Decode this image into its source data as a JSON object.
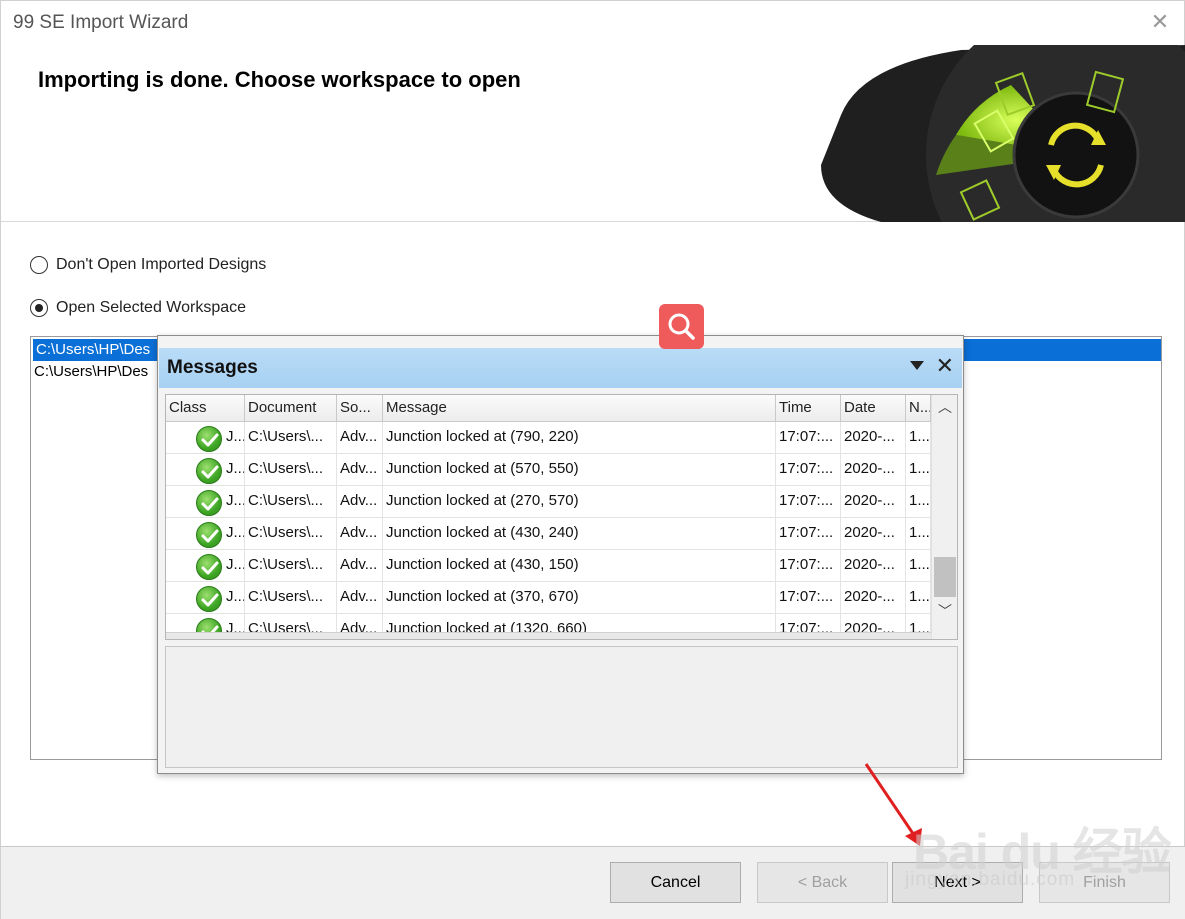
{
  "window": {
    "title": "99 SE Import Wizard",
    "close_icon": "close-icon"
  },
  "header": {
    "headline": "Importing is done. Choose workspace to open"
  },
  "options": [
    {
      "label": "Don't Open Imported Designs",
      "checked": false
    },
    {
      "label": "Open Selected Workspace",
      "checked": true
    }
  ],
  "workspaces": [
    {
      "path": "C:\\Users\\HP\\Des",
      "selected": true
    },
    {
      "path": "C:\\Users\\HP\\Des",
      "selected": false
    }
  ],
  "buttons": {
    "cancel": "Cancel",
    "back": "< Back",
    "next": "Next >",
    "finish": "Finish"
  },
  "messages": {
    "title": "Messages",
    "columns": [
      "Class",
      "Document",
      "So...",
      "Message",
      "Time",
      "Date",
      "N..."
    ],
    "rows": [
      {
        "class": "J...",
        "document": "C:\\Users\\...",
        "source": "Adv...",
        "message": "Junction locked at (790, 220)",
        "time": "17:07:...",
        "date": "2020-...",
        "no": "1..."
      },
      {
        "class": "J...",
        "document": "C:\\Users\\...",
        "source": "Adv...",
        "message": "Junction locked at (570, 550)",
        "time": "17:07:...",
        "date": "2020-...",
        "no": "1..."
      },
      {
        "class": "J...",
        "document": "C:\\Users\\...",
        "source": "Adv...",
        "message": "Junction locked at (270, 570)",
        "time": "17:07:...",
        "date": "2020-...",
        "no": "1..."
      },
      {
        "class": "J...",
        "document": "C:\\Users\\...",
        "source": "Adv...",
        "message": "Junction locked at (430, 240)",
        "time": "17:07:...",
        "date": "2020-...",
        "no": "1..."
      },
      {
        "class": "J...",
        "document": "C:\\Users\\...",
        "source": "Adv...",
        "message": "Junction locked at (430, 150)",
        "time": "17:07:...",
        "date": "2020-...",
        "no": "1..."
      },
      {
        "class": "J...",
        "document": "C:\\Users\\...",
        "source": "Adv...",
        "message": "Junction locked at (370, 670)",
        "time": "17:07:...",
        "date": "2020-...",
        "no": "1..."
      },
      {
        "class": "J...",
        "document": "C:\\Users\\...",
        "source": "Adv...",
        "message": "Junction locked at (1320, 660)",
        "time": "17:07:...",
        "date": "2020-...",
        "no": "1..."
      }
    ]
  },
  "watermark": {
    "brand": "Bai du 经验",
    "site": "jingyan.baidu.com"
  },
  "colors": {
    "selection": "#0a6fd6",
    "panel_header": "#a7d0f2",
    "magnifier": "#ef5a5a",
    "check": "#3ea626"
  }
}
